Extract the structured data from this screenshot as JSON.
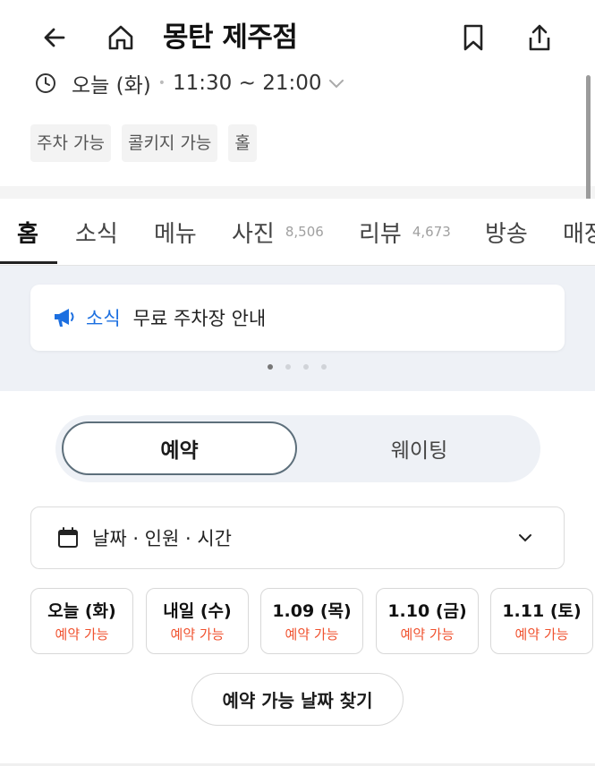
{
  "header": {
    "title": "몽탄 제주점",
    "back_icon": "back-arrow-icon",
    "home_icon": "home-icon",
    "bookmark_icon": "bookmark-icon",
    "share_icon": "share-icon"
  },
  "hours": {
    "day": "오늘 (화)",
    "time": "11:30 ~ 21:00",
    "icon": "clock-icon"
  },
  "tags": [
    "주차 가능",
    "콜키지 가능",
    "홀"
  ],
  "tabs": [
    {
      "label": "홈",
      "count": ""
    },
    {
      "label": "소식",
      "count": ""
    },
    {
      "label": "메뉴",
      "count": ""
    },
    {
      "label": "사진",
      "count": "8,506"
    },
    {
      "label": "리뷰",
      "count": "4,673"
    },
    {
      "label": "방송",
      "count": ""
    },
    {
      "label": "매장",
      "count": ""
    }
  ],
  "news": {
    "label": "소식",
    "text": "무료 주차장 안내",
    "icon": "megaphone-icon",
    "page_count": 4,
    "active_page": 1
  },
  "segment": {
    "active": "예약",
    "other": "웨이팅"
  },
  "picker": {
    "label": "날짜 · 인원 · 시간",
    "icon": "calendar-icon"
  },
  "dates": [
    {
      "date": "오늘 (화)",
      "status": "예약 가능"
    },
    {
      "date": "내일 (수)",
      "status": "예약 가능"
    },
    {
      "date": "1.09 (목)",
      "status": "예약 가능"
    },
    {
      "date": "1.10 (금)",
      "status": "예약 가능"
    },
    {
      "date": "1.11 (토)",
      "status": "예약 가능"
    }
  ],
  "find_button": "예약 가능 날짜 찾기",
  "colors": {
    "accent_blue": "#1c6fe0",
    "available_red": "#f0522f",
    "news_bg": "#eef1f6"
  }
}
